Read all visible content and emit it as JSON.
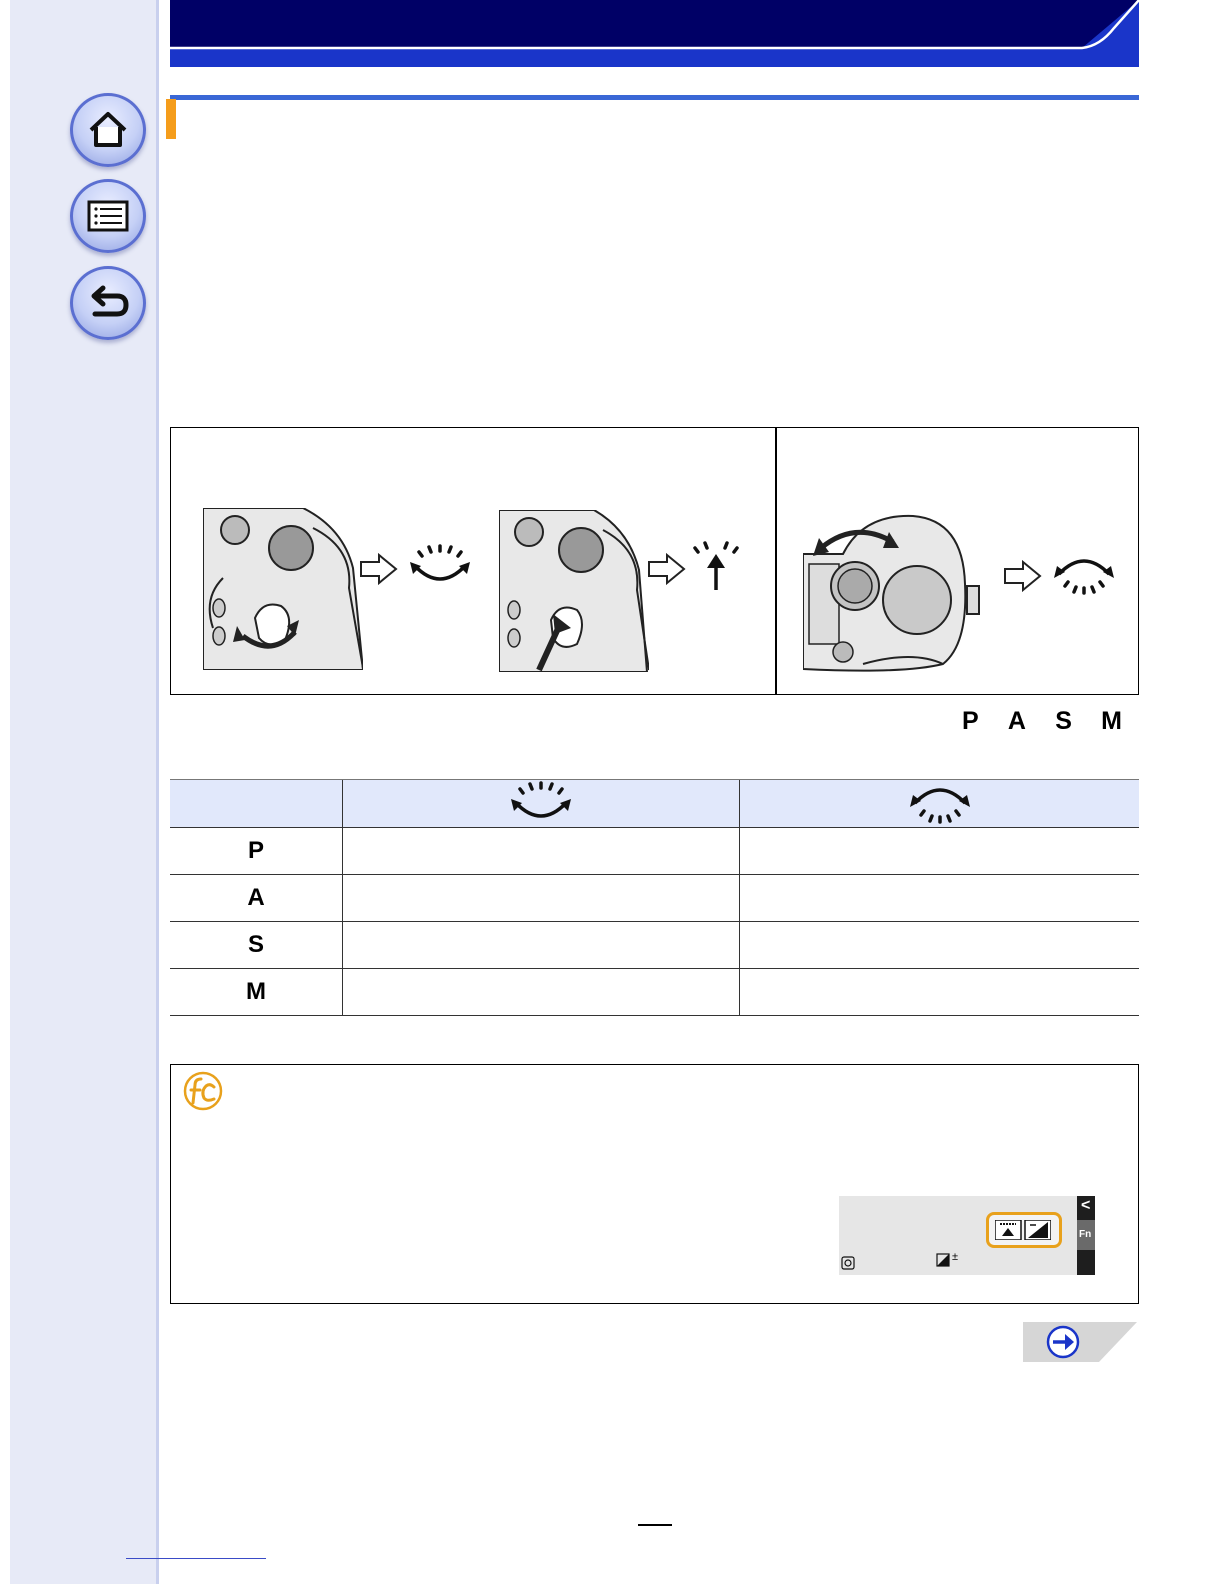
{
  "nav": {
    "home": "home-icon",
    "menu": "menu-list-icon",
    "back": "return-icon"
  },
  "colors": {
    "header": "#000066",
    "header_stripe": "#1a35c9",
    "section_line": "#3a67d6",
    "section_accent": "#f59d1b",
    "sidebar": "#e7eaf7",
    "table_header": "#e1e8fb",
    "fc_icon": "#e8a11c"
  },
  "modes": {
    "letters": [
      "P",
      "A",
      "S",
      "M"
    ]
  },
  "table": {
    "header_icons": [
      "rear-dial-icon",
      "front-dial-icon"
    ],
    "rows": [
      {
        "mode": "P"
      },
      {
        "mode": "A"
      },
      {
        "mode": "S"
      },
      {
        "mode": "M"
      }
    ]
  },
  "info": {
    "icon": "custom-fc-icon",
    "screen_tab_label": "Fn",
    "screen_tab_arrow": "<",
    "screen_exposure_mark": "±"
  },
  "next_icon": "next-arrow-icon"
}
